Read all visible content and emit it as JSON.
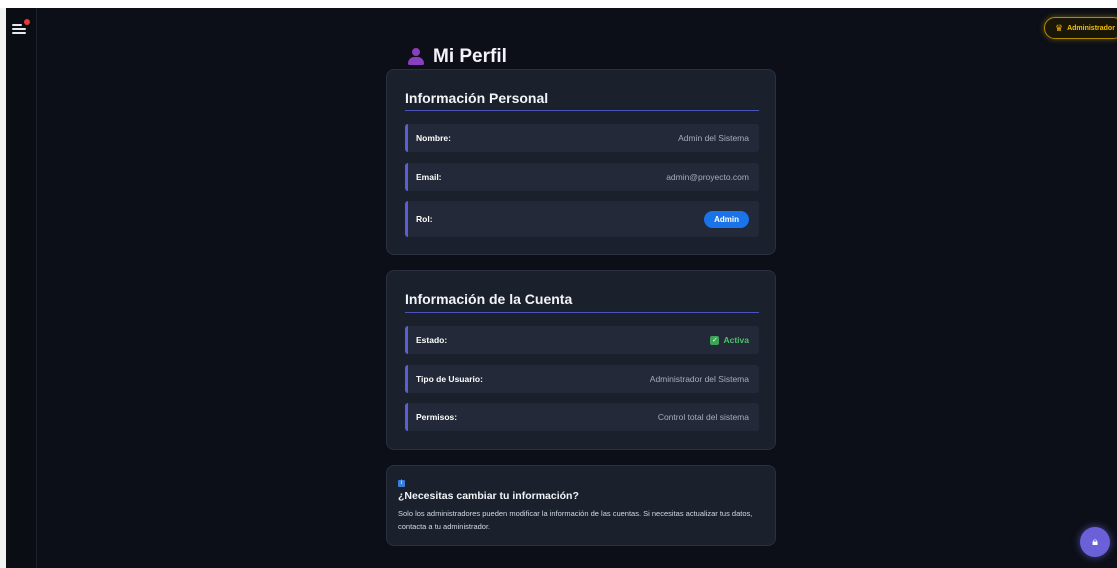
{
  "header": {
    "admin_badge": "Administrador",
    "page_title": "Mi Perfil"
  },
  "personal": {
    "title": "Información Personal",
    "rows": [
      {
        "label": "Nombre:",
        "value": "Admin del Sistema"
      },
      {
        "label": "Email:",
        "value": "admin@proyecto.com"
      },
      {
        "label": "Rol:",
        "value": "Admin"
      }
    ]
  },
  "account": {
    "title": "Información de la Cuenta",
    "rows": [
      {
        "label": "Estado:",
        "value": "Activa"
      },
      {
        "label": "Tipo de Usuario:",
        "value": "Administrador del Sistema"
      },
      {
        "label": "Permisos:",
        "value": "Control total del sistema"
      }
    ]
  },
  "help": {
    "title": "¿Necesitas cambiar tu información?",
    "text": "Solo los administradores pueden modificar la información de las cuentas. Si necesitas actualizar tus datos, contacta a tu administrador."
  },
  "icons": {
    "menu": "menu-icon",
    "crown": "crown-icon",
    "user": "user-icon",
    "check": "check-icon",
    "info": "info-icon",
    "fab": "lock-icon"
  },
  "colors": {
    "accent": "#5a5fd6",
    "role_pill": "#1a73e8",
    "active": "#4cc26a",
    "badge": "#f2c200"
  }
}
